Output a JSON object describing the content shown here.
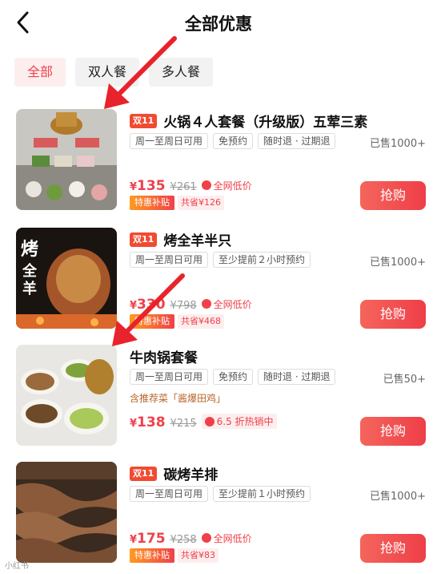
{
  "header": {
    "title": "全部优惠"
  },
  "tabs": [
    {
      "label": "全部",
      "active": true
    },
    {
      "label": "双人餐",
      "active": false
    },
    {
      "label": "多人餐",
      "active": false
    }
  ],
  "items": [
    {
      "badge": "双11",
      "name": "火锅４人套餐（升级版）五荤三素",
      "tags": [
        "周一至周日可用",
        "免预约",
        "随时退 · 过期退"
      ],
      "sold": "已售1000+",
      "rec": "",
      "yen": "¥",
      "price": "135",
      "orig": "¥261",
      "disc": "全网低价",
      "sub1": "特惠补贴",
      "sub2": "共省¥126",
      "buy": "抢购"
    },
    {
      "badge": "双11",
      "name": "烤全羊半只",
      "tags": [
        "周一至周日可用",
        "至少提前２小时预约"
      ],
      "sold": "已售1000+",
      "rec": "",
      "yen": "¥",
      "price": "330",
      "orig": "¥798",
      "disc": "全网低价",
      "sub1": "特惠补贴",
      "sub2": "共省¥468",
      "buy": "抢购"
    },
    {
      "badge": "",
      "name": "牛肉锅套餐",
      "tags": [
        "周一至周日可用",
        "免预约",
        "随时退 · 过期退"
      ],
      "sold": "已售50+",
      "rec": "含推荐菜「酱爆田鸡」",
      "yen": "¥",
      "price": "138",
      "orig": "¥215",
      "disc": "6.5 折热销中",
      "sub1": "",
      "sub2": "",
      "buy": "抢购"
    },
    {
      "badge": "双11",
      "name": "碳烤羊排",
      "tags": [
        "周一至周日可用",
        "至少提前１小时预约"
      ],
      "sold": "已售1000+",
      "rec": "",
      "yen": "¥",
      "price": "175",
      "orig": "¥258",
      "disc": "全网低价",
      "sub1": "特惠补贴",
      "sub2": "共省¥83",
      "buy": "抢购"
    }
  ],
  "thumb_text": {
    "item2": "烤全羊"
  },
  "watermark": "小红书",
  "colors": {
    "accent": "#f0404a",
    "arrow": "#e8232b"
  }
}
